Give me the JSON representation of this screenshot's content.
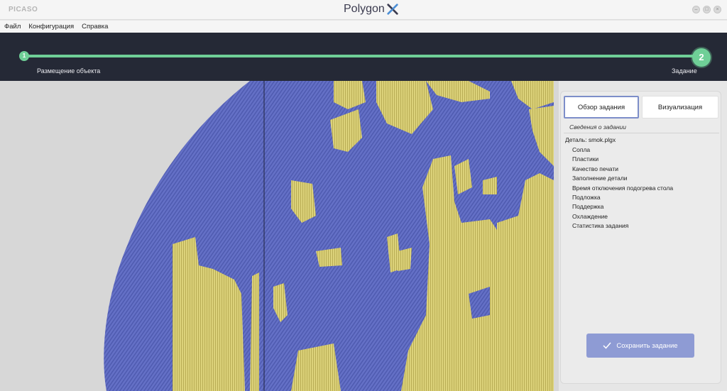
{
  "window": {
    "brand": "PICASO",
    "app_title": "Polygon"
  },
  "menu": {
    "items": [
      "Файл",
      "Конфигурация",
      "Справка"
    ]
  },
  "stepper": {
    "steps": [
      {
        "number": "1",
        "label": "Размещение объекта"
      },
      {
        "number": "2",
        "label": "Задание"
      }
    ],
    "progress": 1.0
  },
  "panel": {
    "tabs": [
      "Обзор задания",
      "Визуализация"
    ],
    "active_tab": "Обзор задания",
    "section_caption": "Сведения о задании",
    "detail_title": "Деталь: smok.plgx",
    "items": [
      "Сопла",
      "Пластики",
      "Качество печати",
      "Заполнение детали",
      "Время отключения подогрева стола",
      "Подложка",
      "Поддержка",
      "Охлаждение",
      "Статистика задания"
    ],
    "save_button": "Сохранить задание"
  },
  "viewport": {
    "description_colors": {
      "model": "#6470c6",
      "support": "#dcd27a",
      "background": "#d7d7d7"
    }
  },
  "colors": {
    "accent": "#6fcf97",
    "header_bg": "#252936",
    "button": "#8e9bd4"
  }
}
